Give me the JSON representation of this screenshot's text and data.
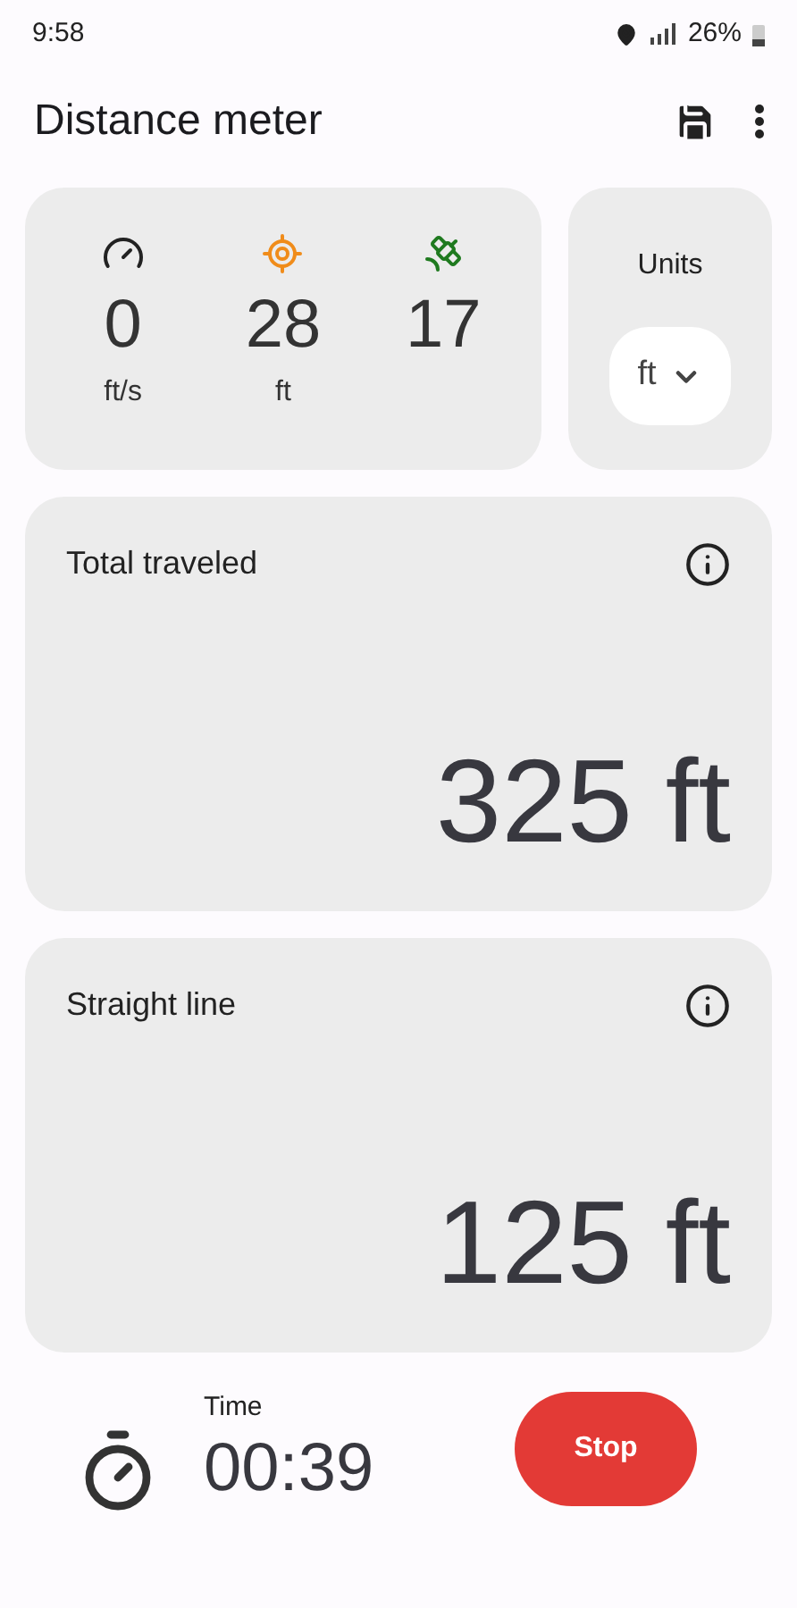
{
  "status_bar": {
    "time": "9:58",
    "battery": "26%"
  },
  "app_bar": {
    "title": "Distance meter"
  },
  "stats": [
    {
      "kind": "speed",
      "value": "0",
      "unit": "ft/s"
    },
    {
      "kind": "accuracy",
      "value": "28",
      "unit": "ft"
    },
    {
      "kind": "satellites",
      "value": "17"
    }
  ],
  "units": {
    "label": "Units",
    "value": "ft"
  },
  "distances": [
    {
      "title": "Total traveled",
      "value": "325 ft"
    },
    {
      "title": "Straight line",
      "value": "125 ft"
    }
  ],
  "timer": {
    "label": "Time",
    "value": "00:39"
  },
  "button": {
    "label": "Stop"
  }
}
